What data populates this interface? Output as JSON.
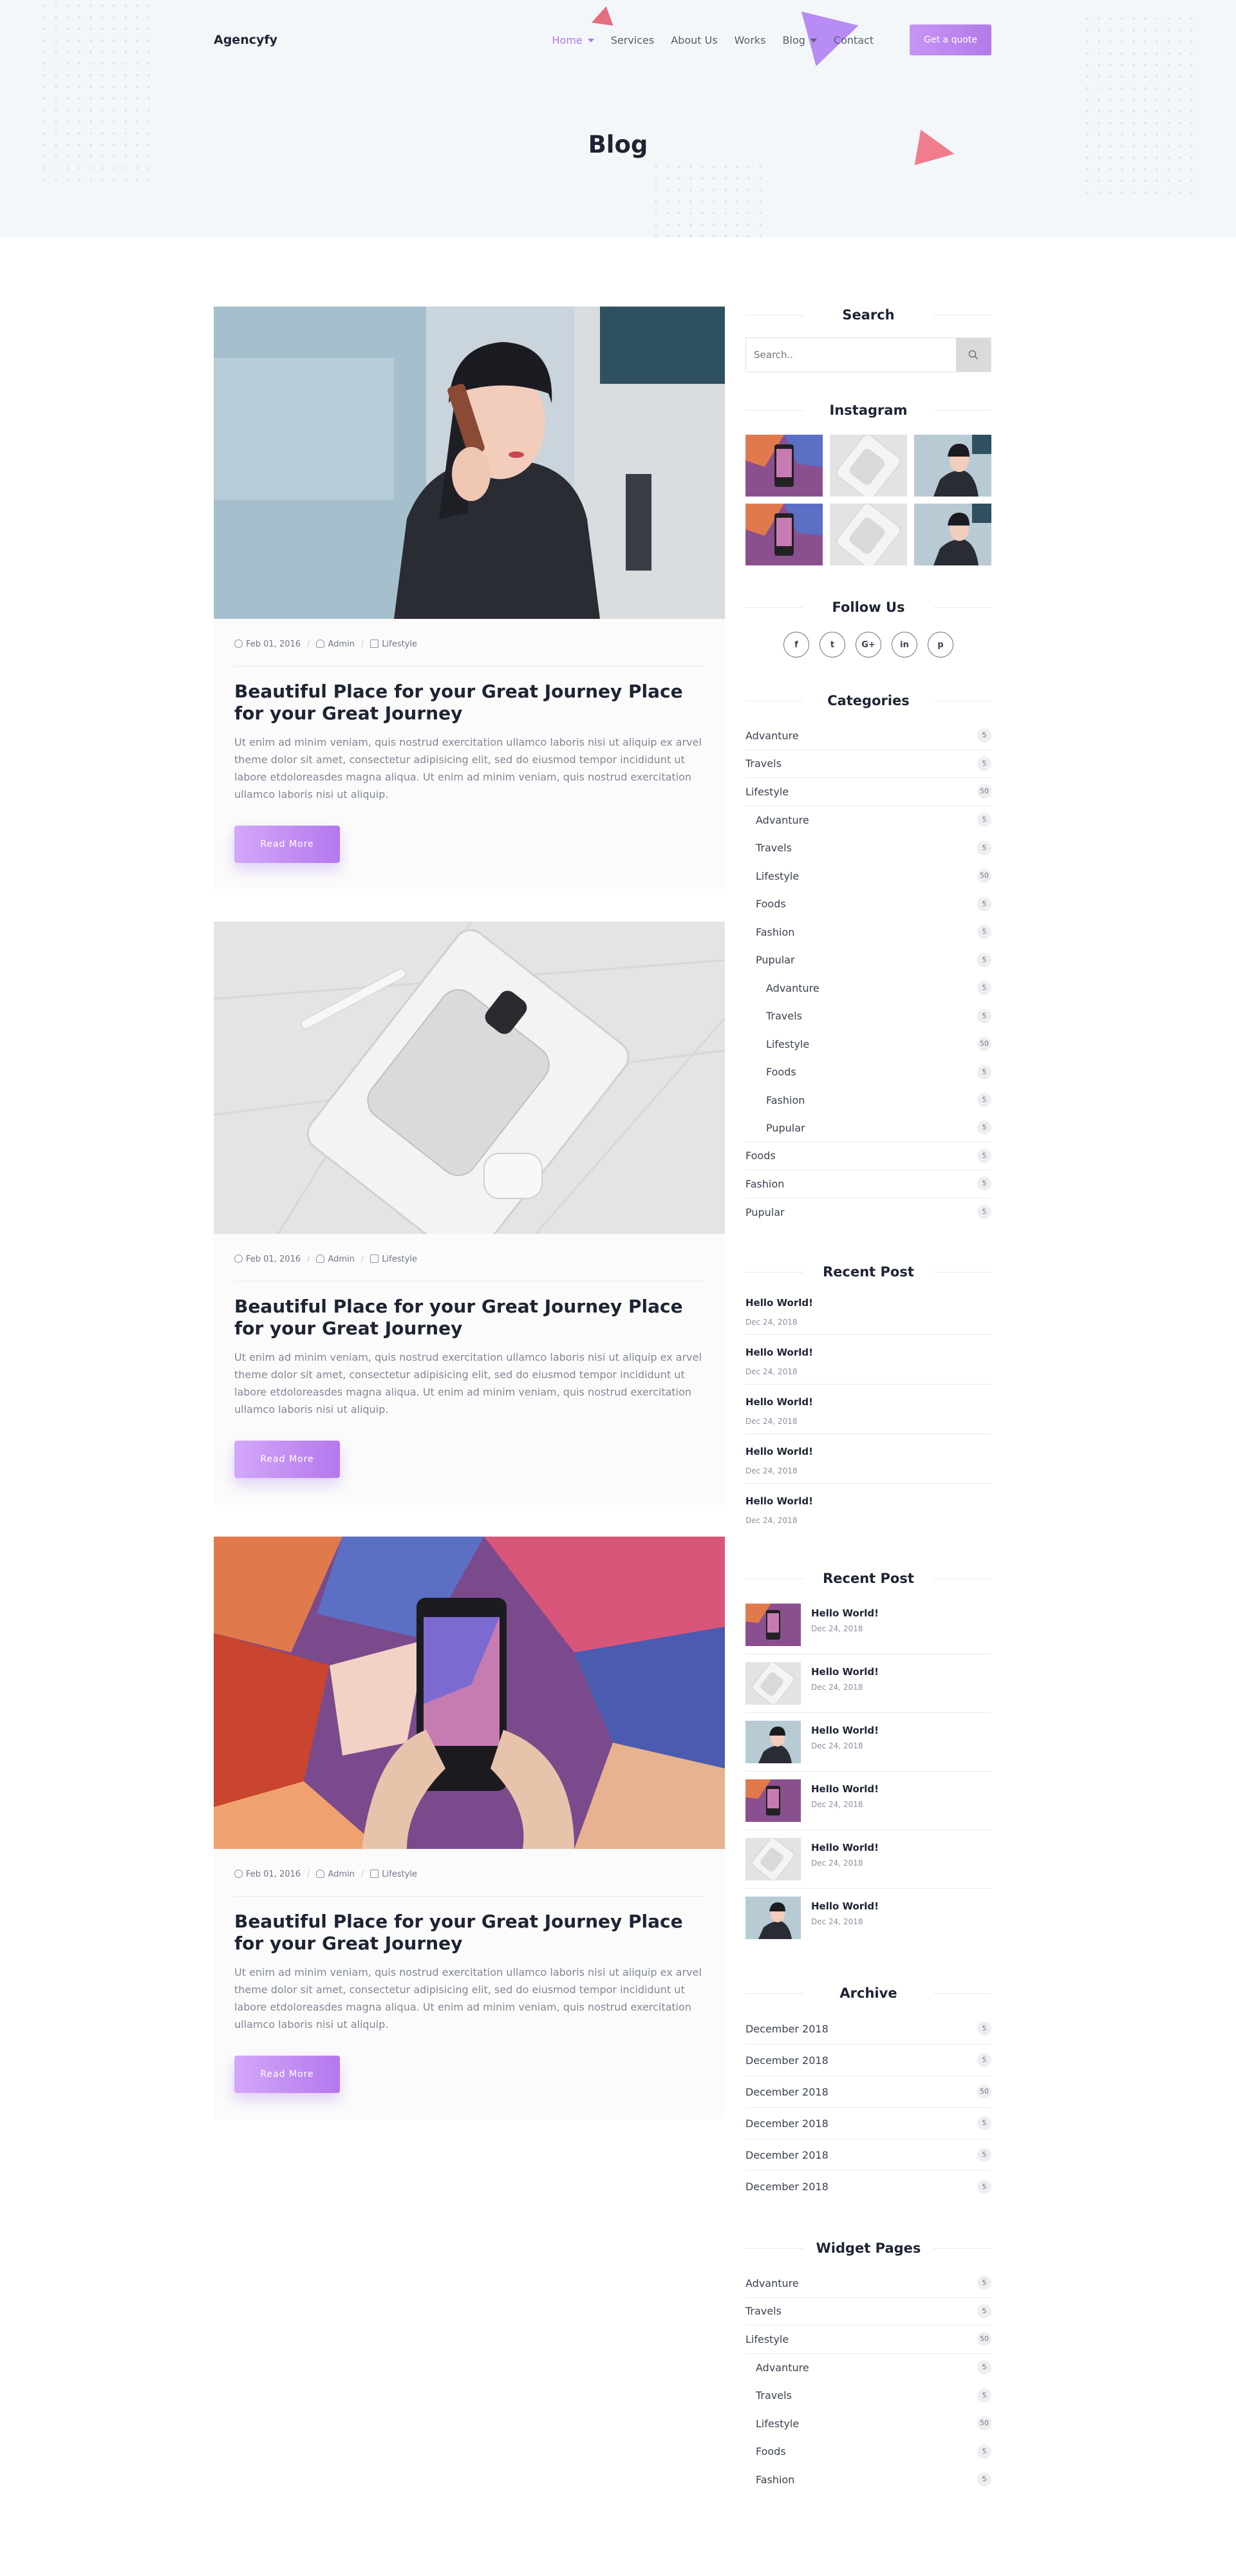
{
  "brand": {
    "logo": "Agencyfy",
    "accent": "#b277e9"
  },
  "nav": {
    "items": [
      {
        "label": "Home",
        "dropdown": true,
        "active": true
      },
      {
        "label": "Services"
      },
      {
        "label": "About Us"
      },
      {
        "label": "Works"
      },
      {
        "label": "Blog",
        "dropdown": true
      },
      {
        "label": "Contact"
      }
    ],
    "cta": "Get a quote"
  },
  "page": {
    "title": "Blog"
  },
  "posts": [
    {
      "image": "woman-on-phone",
      "date": "Feb 01, 2016",
      "author": "Admin",
      "category": "Lifestyle",
      "title": "Beautiful Place for your Great Journey Place for your Great Journey",
      "excerpt": "Ut enim ad minim veniam, quis nostrud exercitation ullamco laboris nisi ut aliquip ex arvel theme dolor sit amet, consectetur adipisicing elit, sed do eiusmod tempor incididunt ut labore etdoloreasdes magna aliqua. Ut enim ad minim veniam, quis nostrud exercitation ullamco laboris nisi ut aliquip.",
      "button": "Read More"
    },
    {
      "image": "white-phone-tablet",
      "date": "Feb 01, 2016",
      "author": "Admin",
      "category": "Lifestyle",
      "title": "Beautiful Place for your Great Journey Place for your Great Journey",
      "excerpt": "Ut enim ad minim veniam, quis nostrud exercitation ullamco laboris nisi ut aliquip ex arvel theme dolor sit amet, consectetur adipisicing elit, sed do eiusmod tempor incididunt ut labore etdoloreasdes magna aliqua. Ut enim ad minim veniam, quis nostrud exercitation ullamco laboris nisi ut aliquip.",
      "button": "Read More"
    },
    {
      "image": "phone-graffiti",
      "date": "Feb 01, 2016",
      "author": "Admin",
      "category": "Lifestyle",
      "title": "Beautiful Place for your Great Journey Place for your Great Journey",
      "excerpt": "Ut enim ad minim veniam, quis nostrud exercitation ullamco laboris nisi ut aliquip ex arvel theme dolor sit amet, consectetur adipisicing elit, sed do eiusmod tempor incididunt ut labore etdoloreasdes magna aliqua. Ut enim ad minim veniam, quis nostrud exercitation ullamco laboris nisi ut aliquip.",
      "button": "Read More"
    }
  ],
  "sidebar": {
    "search": {
      "title": "Search",
      "placeholder": "Search.."
    },
    "instagram": {
      "title": "Instagram"
    },
    "follow": {
      "title": "Follow Us",
      "icons": [
        "f",
        "t",
        "G+",
        "in",
        "p"
      ]
    },
    "categories": {
      "title": "Categories",
      "items": [
        {
          "label": "Advanture",
          "count": "5",
          "level": 0
        },
        {
          "label": "Travels",
          "count": "5",
          "level": 0
        },
        {
          "label": "Lifestyle",
          "count": "50",
          "level": 0
        },
        {
          "label": "Advanture",
          "count": "5",
          "level": 1
        },
        {
          "label": "Travels",
          "count": "5",
          "level": 1
        },
        {
          "label": "Lifestyle",
          "count": "50",
          "level": 1
        },
        {
          "label": "Foods",
          "count": "5",
          "level": 1
        },
        {
          "label": "Fashion",
          "count": "5",
          "level": 1
        },
        {
          "label": "Pupular",
          "count": "5",
          "level": 1
        },
        {
          "label": "Advanture",
          "count": "5",
          "level": 2
        },
        {
          "label": "Travels",
          "count": "5",
          "level": 2
        },
        {
          "label": "Lifestyle",
          "count": "50",
          "level": 2
        },
        {
          "label": "Foods",
          "count": "5",
          "level": 2
        },
        {
          "label": "Fashion",
          "count": "5",
          "level": 2
        },
        {
          "label": "Pupular",
          "count": "5",
          "level": 2
        },
        {
          "label": "Foods",
          "count": "5",
          "level": 0
        },
        {
          "label": "Fashion",
          "count": "5",
          "level": 0
        },
        {
          "label": "Pupular",
          "count": "5",
          "level": 0
        }
      ]
    },
    "recent_text": {
      "title": "Recent Post",
      "items": [
        {
          "title": "Hello World!",
          "date": "Dec 24, 2018"
        },
        {
          "title": "Hello World!",
          "date": "Dec 24, 2018"
        },
        {
          "title": "Hello World!",
          "date": "Dec 24, 2018"
        },
        {
          "title": "Hello World!",
          "date": "Dec 24, 2018"
        },
        {
          "title": "Hello World!",
          "date": "Dec 24, 2018"
        }
      ]
    },
    "recent_thumb": {
      "title": "Recent Post",
      "items": [
        {
          "title": "Hello World!",
          "date": "Dec 24, 2018"
        },
        {
          "title": "Hello World!",
          "date": "Dec 24, 2018"
        },
        {
          "title": "Hello World!",
          "date": "Dec 24, 2018"
        },
        {
          "title": "Hello World!",
          "date": "Dec 24, 2018"
        },
        {
          "title": "Hello World!",
          "date": "Dec 24, 2018"
        },
        {
          "title": "Hello World!",
          "date": "Dec 24, 2018"
        }
      ]
    },
    "archive": {
      "title": "Archive",
      "items": [
        {
          "label": "December 2018",
          "count": "5"
        },
        {
          "label": "December 2018",
          "count": "5"
        },
        {
          "label": "December 2018",
          "count": "50"
        },
        {
          "label": "December 2018",
          "count": "5"
        },
        {
          "label": "December 2018",
          "count": "5"
        },
        {
          "label": "December 2018",
          "count": "5"
        }
      ]
    },
    "widget_pages": {
      "title": "Widget Pages",
      "items": [
        {
          "label": "Advanture",
          "count": "5",
          "level": 0
        },
        {
          "label": "Travels",
          "count": "5",
          "level": 0
        },
        {
          "label": "Lifestyle",
          "count": "50",
          "level": 0
        },
        {
          "label": "Advanture",
          "count": "5",
          "level": 1
        },
        {
          "label": "Travels",
          "count": "5",
          "level": 1
        },
        {
          "label": "Lifestyle",
          "count": "50",
          "level": 1
        },
        {
          "label": "Foods",
          "count": "5",
          "level": 1
        },
        {
          "label": "Fashion",
          "count": "5",
          "level": 1
        }
      ]
    }
  }
}
